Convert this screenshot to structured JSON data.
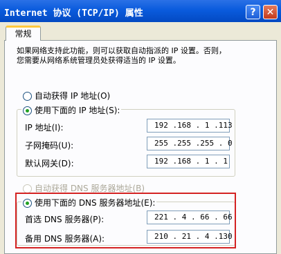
{
  "window": {
    "title": "Internet 协议 (TCP/IP) 属性",
    "help_label": "?",
    "close_label": "✕"
  },
  "tabs": [
    {
      "label": "常规"
    }
  ],
  "description": {
    "line1": "如果网络支持此功能，则可以获取自动指派的 IP 设置。否则，",
    "line2": "您需要从网络系统管理员处获得适当的 IP 设置。"
  },
  "ip_section": {
    "auto_label": "自动获得 IP 地址(O)",
    "manual_label": "使用下面的 IP 地址(S):",
    "rows": [
      {
        "label": "IP 地址(I):",
        "value": "192 .168 . 1 .113"
      },
      {
        "label": "子网掩码(U):",
        "value": "255 .255 .255 . 0"
      },
      {
        "label": "默认网关(D):",
        "value": "192 .168 . 1 . 1"
      }
    ]
  },
  "dns_section": {
    "auto_label": "自动获得 DNS 服务器地址(B)",
    "manual_label": "使用下面的 DNS 服务器地址(E):",
    "rows": [
      {
        "label": "首选 DNS 服务器(P):",
        "value": "221 . 4 . 66 . 66"
      },
      {
        "label": "备用 DNS 服务器(A):",
        "value": "210 . 21 . 4 .130"
      }
    ]
  },
  "colors": {
    "titlebar": "#0A5BDD",
    "highlight": "#D42222",
    "tab_accent": "#FFC83C"
  }
}
